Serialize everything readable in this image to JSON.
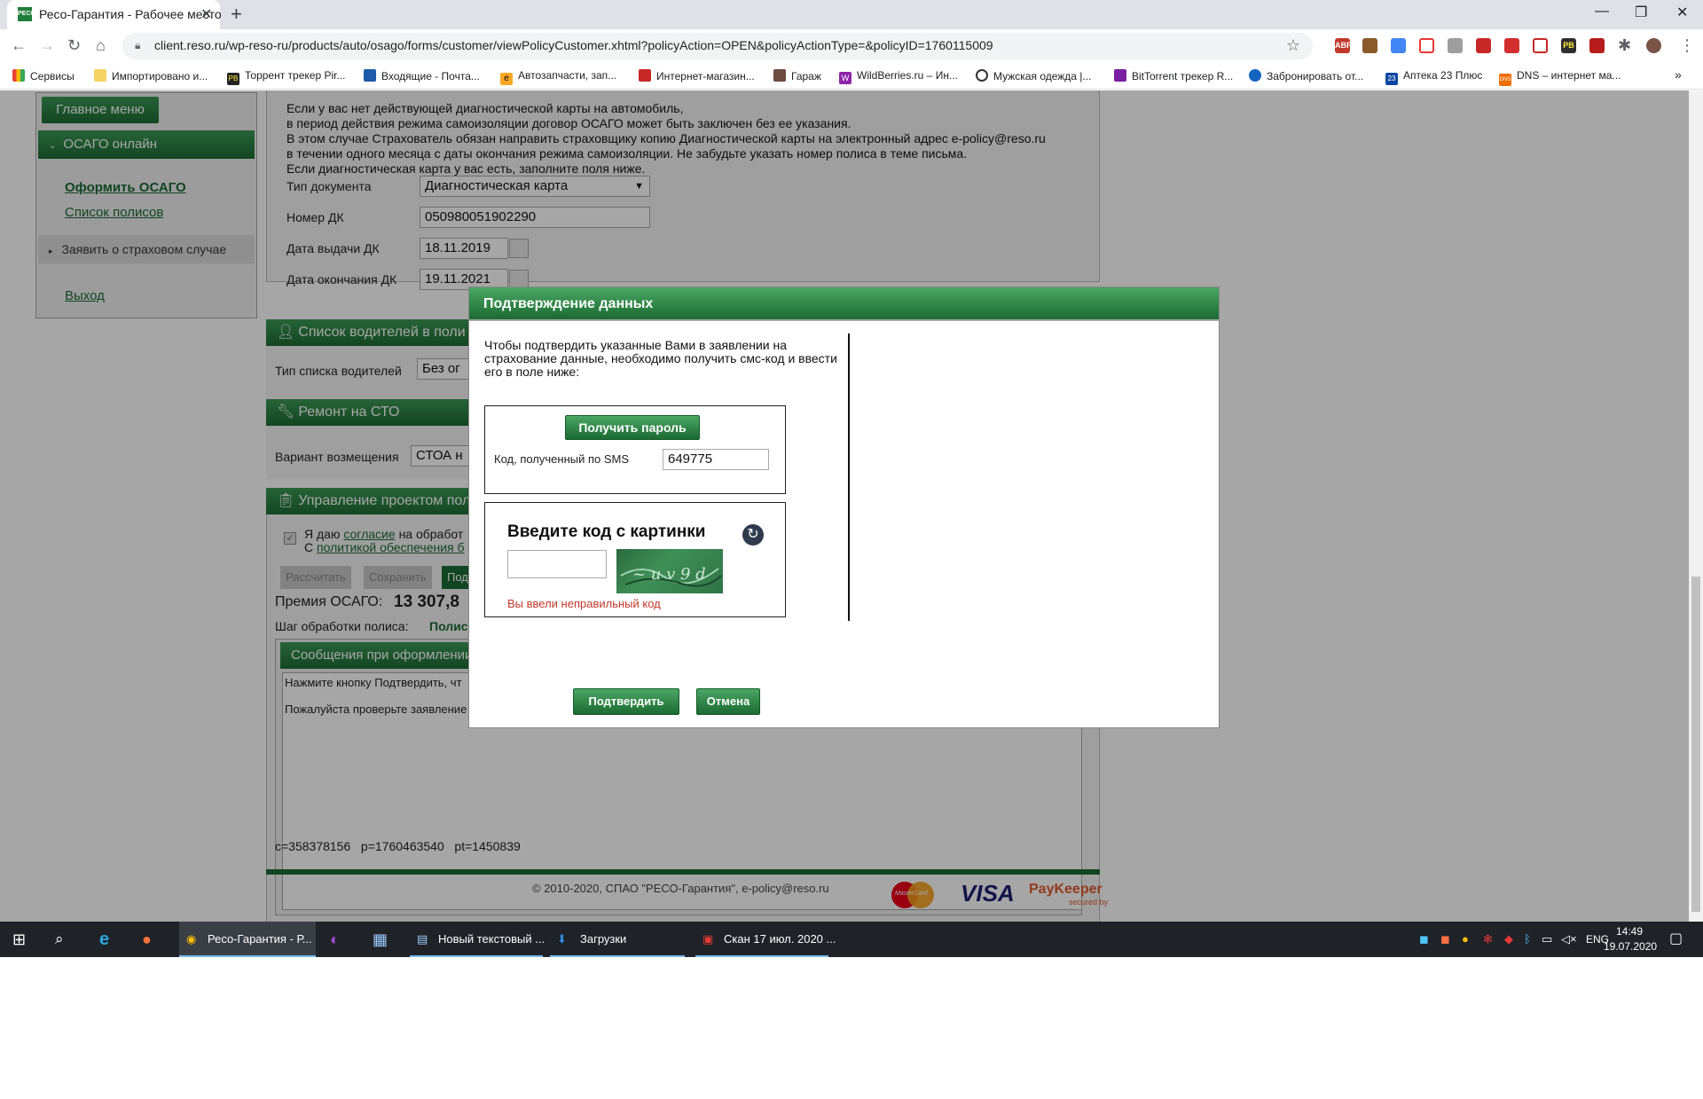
{
  "browser": {
    "tab_title": "Ресо-Гарантия - Рабочее место",
    "favicon_text": "РЕСО",
    "url": "client.reso.ru/wp-reso-ru/products/auto/osago/forms/customer/viewPolicyCustomer.xhtml?policyAction=OPEN&policyActionType=&policyID=1760115009",
    "bookmarks": [
      "Сервисы",
      "Импортировано и...",
      "Торрент трекер Pir...",
      "Входящие - Почта...",
      "Автозапчасти, зап...",
      "Интернет-магазин...",
      "Гараж",
      "WildBerries.ru – Ин...",
      "Мужская одежда |...",
      "BitTorrent трекер R...",
      "Забронировать от...",
      "Аптека 23 Плюс",
      "DNS – интернет ма..."
    ],
    "bookmark_icons": [
      "PB",
      "e",
      "W",
      "23",
      "DNS"
    ],
    "extension_labels": [
      "ABP",
      "PB"
    ],
    "more_bookmarks": "»"
  },
  "sidebar": {
    "main_menu": "Главное меню",
    "osago_online": "ОСАГО онлайн",
    "issue_osago": "Оформить ОСАГО",
    "policy_list": "Список полисов",
    "claim": "Заявить о страховом случае",
    "logout": "Выход"
  },
  "form": {
    "info_lines": [
      "Если у вас нет действующей диагностической карты на автомобиль,",
      "в период действия режима самоизоляции договор ОСАГО может быть заключен без ее указания.",
      "В этом случае Страхователь обязан направить страховщику копию Диагностической карты на электронный адрес e-policy@reso.ru",
      "в течении одного месяца с даты окончания режима самоизоляции. Не забудьте указать номер полиса в теме письма.",
      "Если диагностическая карта у вас есть, заполните поля ниже."
    ],
    "doc_type_label": "Тип документа",
    "doc_type_value": "Диагностическая карта",
    "dk_number_label": "Номер ДК",
    "dk_number_value": "050980051902290",
    "dk_issue_label": "Дата выдачи ДК",
    "dk_issue_value": "18.11.2019",
    "dk_end_label": "Дата окончания ДК",
    "dk_end_value": "19.11.2021",
    "drivers_header": "Список водителей в поли",
    "drivers_type_label": "Тип списка водителей",
    "drivers_type_value": "Без ог",
    "repair_header": "Ремонт на СТО",
    "compensation_label": "Вариант возмещения",
    "compensation_value": "СТОА н",
    "project_header": "Управление проектом пол",
    "agree_text_1": "Я даю",
    "agree_link_1": "согласие",
    "agree_text_1b": "на обработ",
    "agree_text_2": "С",
    "agree_link_2": "политикой обеспечения б",
    "btn_calculate": "Рассчитать",
    "btn_save": "Сохранить",
    "btn_submit": "Под",
    "premium_label": "Премия ОСАГО:",
    "premium_value": "13 307,8",
    "step_label": "Шаг обработки полиса:",
    "step_value": "Полис",
    "messages_header": "Сообщения при оформлении",
    "message_1": "Нажмите кнопку Подтвердить, чт",
    "message_2": "Пожалуйста проверьте заявление",
    "ids": "c=358378156   p=1760463540   pt=1450839"
  },
  "footer": {
    "copyright": "© 2010-2020, СПАО \"РЕСО-Гарантия\", e-policy@reso.ru",
    "mastercard": "MasterCard",
    "visa": "VISA",
    "paykeeper": "PayKeeper",
    "paykeeper_sub": "secured by"
  },
  "modal": {
    "title": "Подтверждение данных",
    "description": "Чтобы подтвердить указанные Вами в заявлении на страхование данные, необходимо получить смс-код и ввести его в поле ниже:",
    "get_password": "Получить пароль",
    "sms_label": "Код, полученный по SMS",
    "sms_value": "649775",
    "captcha_title": "Введите код с картинки",
    "captcha_value": "",
    "captcha_error": "Вы ввели неправильный код",
    "confirm": "Подтвердить",
    "cancel": "Отмена"
  },
  "taskbar": {
    "chrome_label": "Ресо-Гарантия - Р...",
    "notepad_label": "Новый текстовый ...",
    "downloads_label": "Загрузки",
    "pdf_label": "Скан 17 июл. 2020 ...",
    "lang": "ENG",
    "time": "14:49",
    "date": "19.07.2020"
  },
  "colors": {
    "brand_green": "#1d6b34",
    "error_red": "#c0392b"
  }
}
